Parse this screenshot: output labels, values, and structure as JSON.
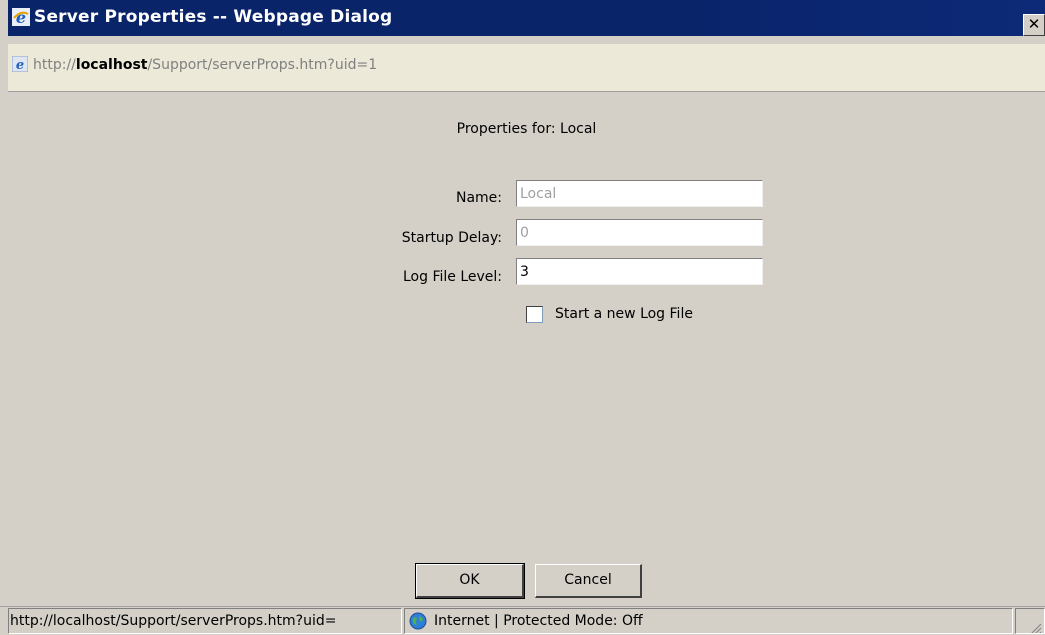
{
  "window": {
    "title": "Server Properties -- Webpage Dialog",
    "close_label": "✕"
  },
  "address": {
    "scheme": "http://",
    "host": "localhost",
    "path": "/Support/serverProps.htm?uid=1"
  },
  "form": {
    "heading": "Properties for: Local",
    "name_label": "Name:",
    "name_value": "Local",
    "startup_delay_label": "Startup Delay:",
    "startup_delay_value": "0",
    "log_level_label": "Log File Level:",
    "log_level_value": "3",
    "new_log_label": "Start a new Log File",
    "new_log_checked": false
  },
  "buttons": {
    "ok": "OK",
    "cancel": "Cancel"
  },
  "status": {
    "url": "http://localhost/Support/serverProps.htm?uid=",
    "zone": "Internet | Protected Mode: Off"
  },
  "icons": [
    "ie-icon",
    "ie-page-icon",
    "globe-icon",
    "resize-grip-icon"
  ]
}
